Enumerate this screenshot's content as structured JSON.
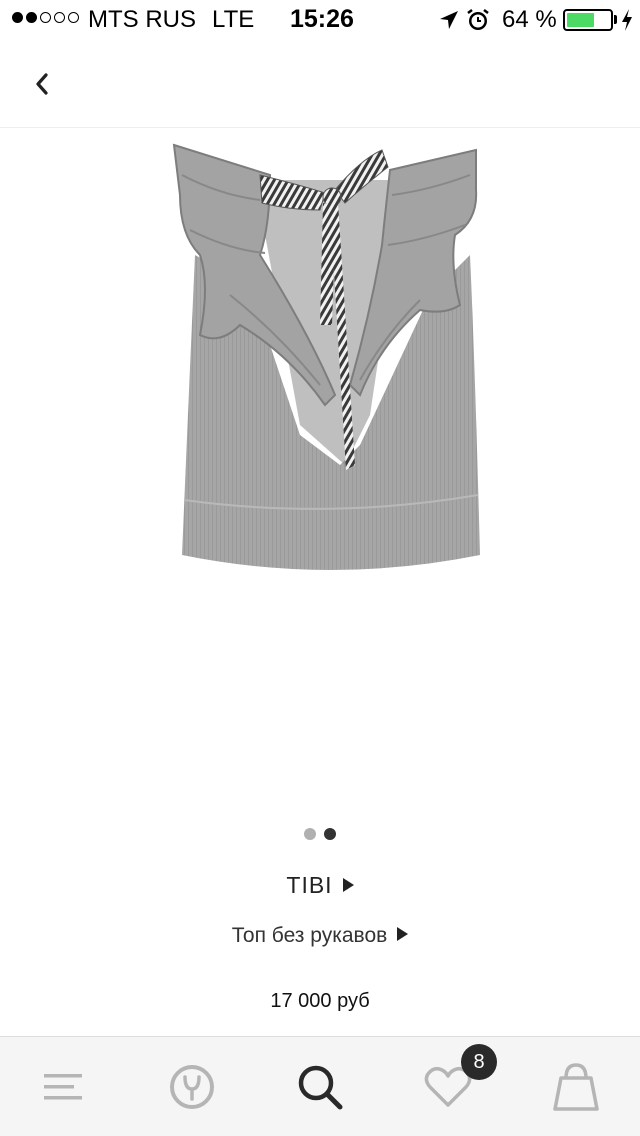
{
  "status_bar": {
    "carrier": "MTS RUS",
    "network": "LTE",
    "time": "15:26",
    "battery_percent": "64 %",
    "battery_level": 0.64,
    "signal_strength": 2,
    "signal_max": 5
  },
  "nav": {
    "back_icon": "chevron-left-icon"
  },
  "product": {
    "image_icon": "sleeveless-ruffle-top-image",
    "pager": {
      "total": 2,
      "active": 2
    },
    "brand": "TIBI",
    "name": "Топ без рукавов",
    "price": "17 000 руб"
  },
  "tab_bar": {
    "tabs": [
      {
        "icon": "menu-icon",
        "active": false
      },
      {
        "icon": "logo-icon",
        "active": false
      },
      {
        "icon": "search-icon",
        "active": true
      },
      {
        "icon": "heart-icon",
        "active": false
      },
      {
        "icon": "bag-icon",
        "active": false
      }
    ],
    "favorites_badge": "8"
  },
  "colors": {
    "accent": "#2a2a2a",
    "inactive_icon": "#b5b5b5",
    "battery": "#4cd964"
  }
}
